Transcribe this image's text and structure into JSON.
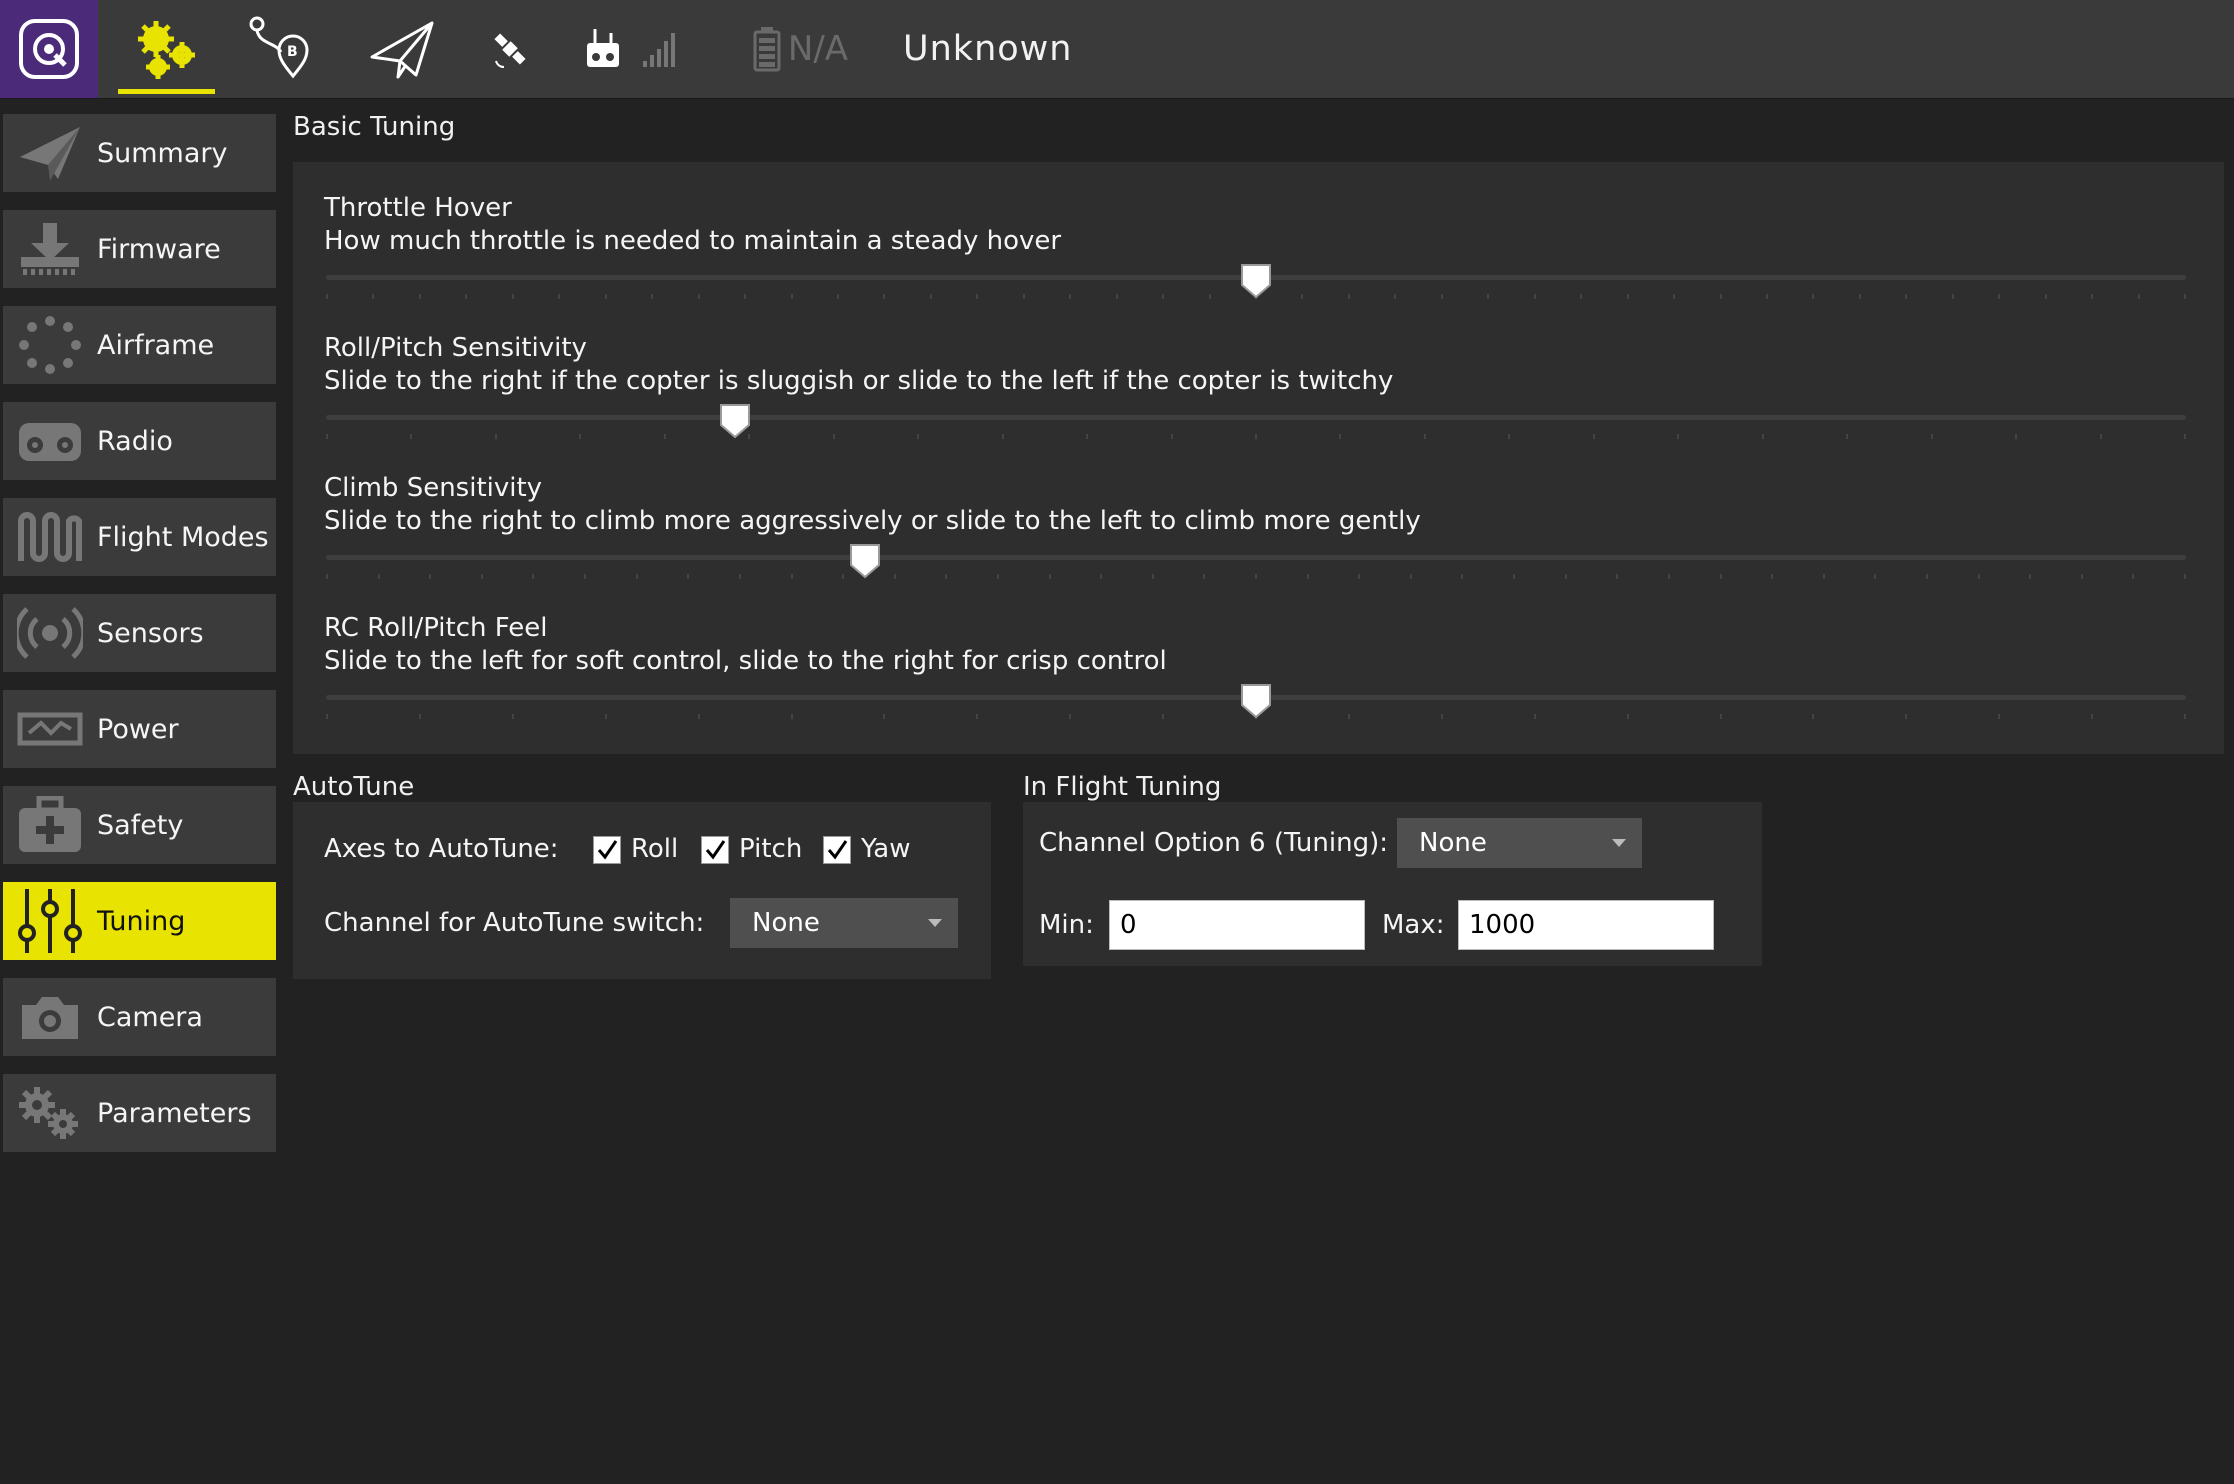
{
  "toolbar": {
    "battery_text": "N/A",
    "vehicle_status": "Unknown",
    "accent_color": "#e8e300",
    "logo_bg_color": "#4b2a7a",
    "icons": [
      "qgc-logo-icon",
      "setup-gears-icon",
      "plan-route-icon",
      "fly-paper-plane-icon",
      "gps-satellite-icon",
      "rc-signal-icon",
      "battery-icon"
    ]
  },
  "sidebar": {
    "items": [
      {
        "label": "Summary",
        "icon": "paper-plane-icon"
      },
      {
        "label": "Firmware",
        "icon": "download-icon"
      },
      {
        "label": "Airframe",
        "icon": "airframe-dots-icon"
      },
      {
        "label": "Radio",
        "icon": "radio-transmitter-icon"
      },
      {
        "label": "Flight Modes",
        "icon": "flight-modes-wave-icon"
      },
      {
        "label": "Sensors",
        "icon": "sensors-broadcast-icon"
      },
      {
        "label": "Power",
        "icon": "power-meter-icon"
      },
      {
        "label": "Safety",
        "icon": "first-aid-kit-icon"
      },
      {
        "label": "Tuning",
        "icon": "tuning-sliders-icon",
        "active": true
      },
      {
        "label": "Camera",
        "icon": "camera-icon"
      },
      {
        "label": "Parameters",
        "icon": "parameters-gears-icon"
      }
    ]
  },
  "basic_tuning": {
    "title": "Basic Tuning",
    "sliders": [
      {
        "title": "Throttle Hover",
        "description": "How much throttle is needed to maintain a steady hover",
        "value_fraction": 0.5
      },
      {
        "title": "Roll/Pitch Sensitivity",
        "description": "Slide to the right if the copter is sluggish or slide to the left if the copter is twitchy",
        "value_fraction": 0.22
      },
      {
        "title": "Climb Sensitivity",
        "description": "Slide to the right to climb more aggressively or slide to the left to climb more gently",
        "value_fraction": 0.29
      },
      {
        "title": "RC Roll/Pitch Feel",
        "description": "Slide to the left for soft control, slide to the right for crisp control",
        "value_fraction": 0.5
      }
    ]
  },
  "autotune": {
    "title": "AutoTune",
    "axes_label": "Axes to AutoTune:",
    "axes": [
      {
        "label": "Roll",
        "checked": true
      },
      {
        "label": "Pitch",
        "checked": true
      },
      {
        "label": "Yaw",
        "checked": true
      }
    ],
    "channel_label": "Channel for AutoTune switch:",
    "channel_value": "None"
  },
  "in_flight_tuning": {
    "title": "In Flight Tuning",
    "channel_option_label": "Channel Option 6 (Tuning):",
    "channel_option_value": "None",
    "min_label": "Min:",
    "min_value": "0",
    "max_label": "Max:",
    "max_value": "1000"
  }
}
